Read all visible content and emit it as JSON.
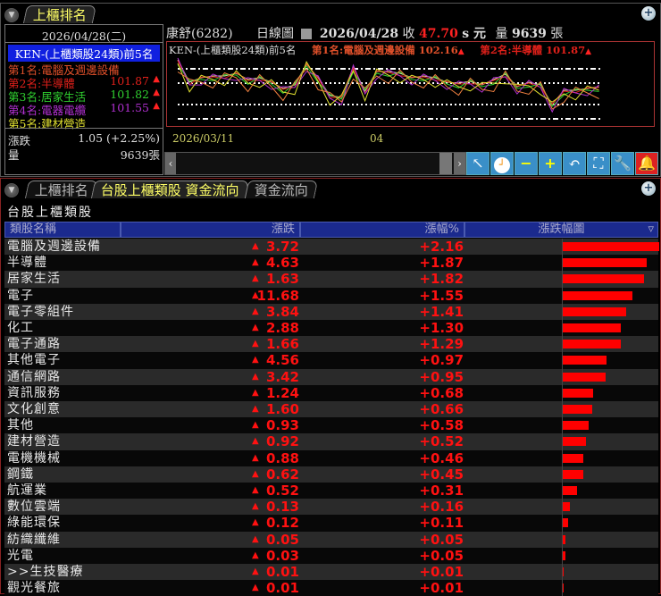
{
  "top_panel": {
    "tab": "上櫃排名",
    "date": "2026/04/28(二)",
    "ranking_title": "KEN-(上櫃類股24類)前5名",
    "ranks": [
      {
        "label": "第1名:電腦及週邊設備",
        "value": "",
        "color": "#e0502a"
      },
      {
        "label": "第2名:半導體",
        "value": "101.87",
        "color": "#e0201a"
      },
      {
        "label": "第3名:居家生活",
        "value": "101.82",
        "color": "#30d030"
      },
      {
        "label": "第4名:電器電纜",
        "value": "101.55",
        "color": "#b030d0"
      },
      {
        "label": "第5名:建材營造",
        "value": "",
        "color": "#e0e030"
      }
    ],
    "change_label": "漲跌",
    "change_value": "1.05 (+2.25%)",
    "volume_label": "量",
    "volume_value": "9639張",
    "stock": "康舒(6282)",
    "chart_type": "日線圖",
    "quote_date": "2026/04/28",
    "close_label": "收",
    "close": "47.70",
    "close_suffix": "s 元",
    "vol_label": "量",
    "vol": "9639",
    "vol_unit": "張",
    "chart_title": "KEN-(上櫃類股24類)前5名",
    "legend1": "第1名:電腦及週邊設備 102.16",
    "legend2": "第2名:半導體 101.87",
    "x_start": "2026/03/11",
    "x_mid": "04"
  },
  "bottom_panel": {
    "tabs": [
      "上櫃排名",
      "台股上櫃類股 資金流向",
      "資金流向"
    ],
    "title": "台股上櫃類股",
    "headers": [
      "類股名稱",
      "漲跌",
      "漲幅%",
      "漲跌幅圖"
    ],
    "rows": [
      {
        "name": "電腦及週邊設備",
        "chg": "3.72",
        "pct": "+2.16",
        "v": 2.16
      },
      {
        "name": "半導體",
        "chg": "4.63",
        "pct": "+1.87",
        "v": 1.87
      },
      {
        "name": "居家生活",
        "chg": "1.63",
        "pct": "+1.82",
        "v": 1.82
      },
      {
        "name": "電子",
        "chg": "11.68",
        "pct": "+1.55",
        "v": 1.55
      },
      {
        "name": "電子零組件",
        "chg": "3.84",
        "pct": "+1.41",
        "v": 1.41
      },
      {
        "name": "化工",
        "chg": "2.88",
        "pct": "+1.30",
        "v": 1.3
      },
      {
        "name": "電子通路",
        "chg": "1.66",
        "pct": "+1.29",
        "v": 1.29
      },
      {
        "name": "其他電子",
        "chg": "4.56",
        "pct": "+0.97",
        "v": 0.97
      },
      {
        "name": "通信網路",
        "chg": "3.42",
        "pct": "+0.95",
        "v": 0.95
      },
      {
        "name": "資訊服務",
        "chg": "1.24",
        "pct": "+0.68",
        "v": 0.68
      },
      {
        "name": "文化創意",
        "chg": "1.60",
        "pct": "+0.66",
        "v": 0.66
      },
      {
        "name": "其他",
        "chg": "0.93",
        "pct": "+0.58",
        "v": 0.58
      },
      {
        "name": "建材營造",
        "chg": "0.92",
        "pct": "+0.52",
        "v": 0.52
      },
      {
        "name": "電機機械",
        "chg": "0.88",
        "pct": "+0.46",
        "v": 0.46
      },
      {
        "name": "鋼鐵",
        "chg": "0.62",
        "pct": "+0.45",
        "v": 0.45
      },
      {
        "name": "航運業",
        "chg": "0.52",
        "pct": "+0.31",
        "v": 0.31
      },
      {
        "name": "數位雲端",
        "chg": "0.13",
        "pct": "+0.16",
        "v": 0.16
      },
      {
        "name": "綠能環保",
        "chg": "0.12",
        "pct": "+0.11",
        "v": 0.11
      },
      {
        "name": "紡織纖維",
        "chg": "0.05",
        "pct": "+0.05",
        "v": 0.05
      },
      {
        "name": "光電",
        "chg": "0.03",
        "pct": "+0.05",
        "v": 0.05
      },
      {
        "name": ">>生技醫療",
        "chg": "0.01",
        "pct": "+0.01",
        "v": 0.01
      },
      {
        "name": "觀光餐旅",
        "chg": "0.01",
        "pct": "+0.01",
        "v": 0.01
      }
    ]
  }
}
